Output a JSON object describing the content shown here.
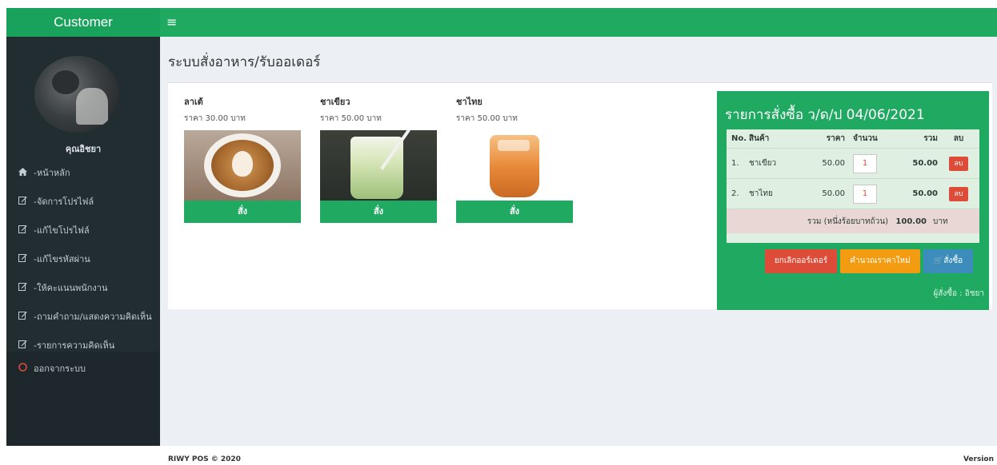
{
  "sidebar": {
    "brand": "Customer",
    "username": "คุณอิชยา",
    "items": [
      {
        "label": "-หน้าหลัก",
        "icon": "home-icon"
      },
      {
        "label": "-จัดการโปรไฟล์",
        "icon": "edit-icon"
      },
      {
        "label": "-แก้ไขโปรไฟล์",
        "icon": "edit-icon"
      },
      {
        "label": "-แก้ไขรหัสผ่าน",
        "icon": "edit-icon"
      },
      {
        "label": "-ให้คะแนนพนักงาน",
        "icon": "edit-icon"
      },
      {
        "label": "-ถามคำถาม/แสดงความคิดเห็น",
        "icon": "edit-icon"
      },
      {
        "label": "-รายการความคิดเห็น",
        "icon": "edit-icon"
      }
    ],
    "logout": "ออกจากระบบ"
  },
  "topbar": {
    "menu_icon": "≡"
  },
  "page": {
    "title": "ระบบสั่งอาหาร/รับออเดอร์"
  },
  "products": [
    {
      "name": "ลาเต้",
      "price": "ราคา 30.00 บาท",
      "button": "สั่ง"
    },
    {
      "name": "ชาเขียว",
      "price": "ราคา 50.00 บาท",
      "button": "สั่ง"
    },
    {
      "name": "ชาไทย",
      "price": "ราคา 50.00 บาท",
      "button": "สั่ง"
    }
  ],
  "order": {
    "title": "รายการสั่งซื้อ ว/ด/ป 04/06/2021",
    "headers": {
      "no": "No.",
      "item": "สินค้า",
      "price": "ราคา",
      "qty": "จำนวน",
      "total": "รวม",
      "del": "ลบ"
    },
    "rows": [
      {
        "no": "1.",
        "item": "ชาเขียว",
        "price": "50.00",
        "qty": "1",
        "total": "50.00",
        "del": "ลบ"
      },
      {
        "no": "2.",
        "item": "ชาไทย",
        "price": "50.00",
        "qty": "1",
        "total": "50.00",
        "del": "ลบ"
      }
    ],
    "sum_label": "รวม (หนึ่งร้อยบาทถ้วน)",
    "sum_total": "100.00",
    "sum_unit": "บาท",
    "cancel_btn": "ยกเลิกออร์เดอร์",
    "recalc_btn": "คำนวณราคาใหม่",
    "order_btn": "🛒สั่งซื้อ",
    "buyer": "ผู้สั่งซื้อ : อิชยา"
  },
  "footer": {
    "left": "RIWY POS © 2020",
    "right": "Version"
  },
  "colors": {
    "brand_green": "#18a25c",
    "topbar_green": "#1fa961",
    "sidebar": "#222d32",
    "danger": "#dd4b39",
    "warning": "#f39c12",
    "info": "#3c8dbc"
  }
}
